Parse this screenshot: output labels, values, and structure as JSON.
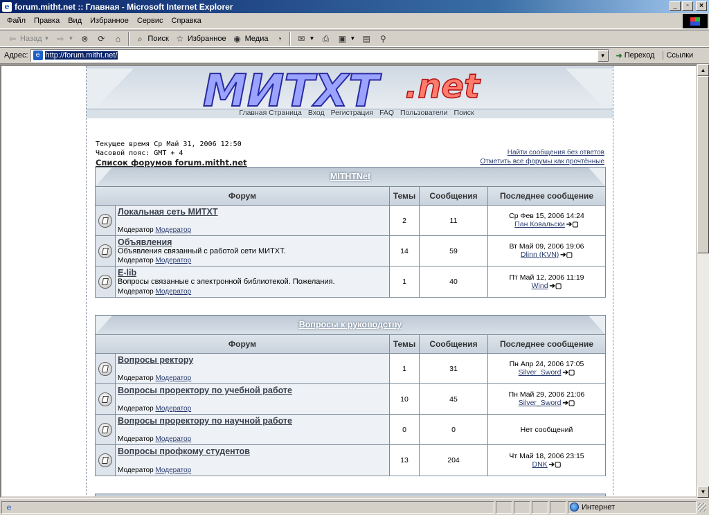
{
  "window": {
    "title": "forum.mitht.net :: Главная - Microsoft Internet Explorer"
  },
  "menu": [
    "Файл",
    "Правка",
    "Вид",
    "Избранное",
    "Сервис",
    "Справка"
  ],
  "toolbar": {
    "back": "Назад",
    "search": "Поиск",
    "favorites": "Избранное",
    "media": "Медиа"
  },
  "address": {
    "label": "Адрес:",
    "url": "http://forum.mitht.net/",
    "go": "Переход",
    "links": "Ссылки"
  },
  "status": {
    "zone": "Интернет"
  },
  "page": {
    "logo_text": "МИТХТ",
    "logo_suffix": ".net",
    "nav": [
      "Главная Страница",
      "Вход",
      "Регистрация",
      "FAQ",
      "Пользователи",
      "Поиск"
    ],
    "current_time": "Текущее время Ср Май 31, 2006 12:50",
    "timezone": "Часовой пояс: GMT + 4",
    "forum_index": "Список форумов forum.mitht.net",
    "unanswered": "Найти сообщения без ответов",
    "mark_read": "Отметить все форумы как прочтённые",
    "col_forum": "Форум",
    "col_topics": "Темы",
    "col_posts": "Сообщения",
    "col_last": "Последнее сообщение",
    "moderator_label": "Модератор",
    "moderator_link": "Модератор",
    "categories": [
      {
        "title": "MITHTNet",
        "forums": [
          {
            "name": "Локальная сеть МИТХТ",
            "desc": "",
            "topics": "2",
            "posts": "11",
            "last_date": "Ср Фев 15, 2006 14:24",
            "last_user": "Пан Ковальски"
          },
          {
            "name": "Объявления",
            "desc": "Объявления связанный с работой сети МИТХТ.",
            "topics": "14",
            "posts": "59",
            "last_date": "Вт Май 09, 2006 19:06",
            "last_user": "Dlinn (KVN)"
          },
          {
            "name": "E-lib",
            "desc": "Вопросы связанные с электронной библиотекой. Пожелания.",
            "topics": "1",
            "posts": "40",
            "last_date": "Пт Май 12, 2006 11:19",
            "last_user": "Wind"
          }
        ]
      },
      {
        "title": "Вопросы к руководству",
        "forums": [
          {
            "name": "Вопросы ректору",
            "desc": "",
            "topics": "1",
            "posts": "31",
            "last_date": "Пн Апр 24, 2006 17:05",
            "last_user": "Silver_Sword"
          },
          {
            "name": "Вопросы проректору по учебной работе",
            "desc": "",
            "topics": "10",
            "posts": "45",
            "last_date": "Пн Май 29, 2006 21:06",
            "last_user": "Silver_Sword"
          },
          {
            "name": "Вопросы проректору по научной работе",
            "desc": "",
            "topics": "0",
            "posts": "0",
            "last_date": "Нет сообщений",
            "last_user": ""
          },
          {
            "name": "Вопросы профкому студентов",
            "desc": "",
            "topics": "13",
            "posts": "204",
            "last_date": "Чт Май 18, 2006 23:15",
            "last_user": "DNK"
          }
        ]
      }
    ]
  }
}
